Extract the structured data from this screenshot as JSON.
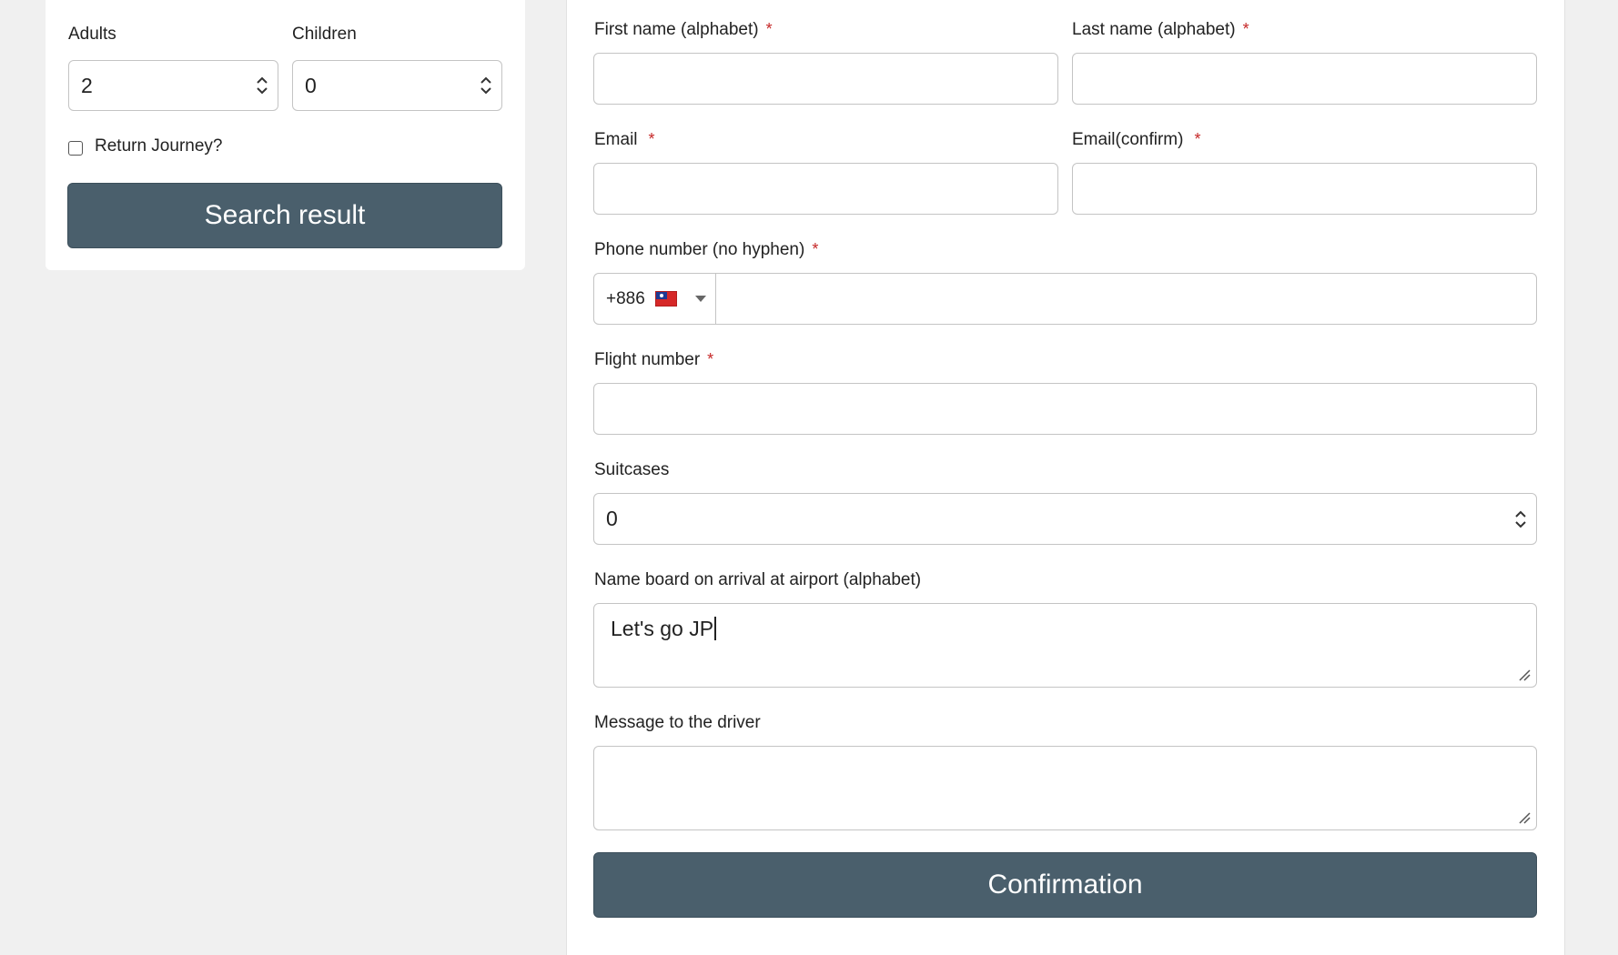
{
  "search_panel": {
    "adults_label": "Adults",
    "adults_value": "2",
    "children_label": "Children",
    "children_value": "0",
    "return_label": "Return Journey?",
    "return_checked": false,
    "search_button": "Search result"
  },
  "booking_form": {
    "first_name_label": "First name (alphabet)",
    "last_name_label": "Last name (alphabet)",
    "email_label": "Email",
    "email_confirm_label": "Email(confirm)",
    "phone_label": "Phone number (no hyphen)",
    "phone_country_code": "+886",
    "phone_flag": "taiwan-flag-icon",
    "flight_label": "Flight number",
    "suitcases_label": "Suitcases",
    "suitcases_value": "0",
    "nameboard_label": "Name board on arrival at airport (alphabet)",
    "nameboard_value": "Let's go JP",
    "message_label": "Message to the driver",
    "message_value": "",
    "confirm_button": "Confirmation",
    "required_mark": "*"
  },
  "colors": {
    "button_bg": "#4a5f6c",
    "required": "#c62828",
    "page_bg": "#f0f0f0",
    "border": "#c4c4c4"
  }
}
